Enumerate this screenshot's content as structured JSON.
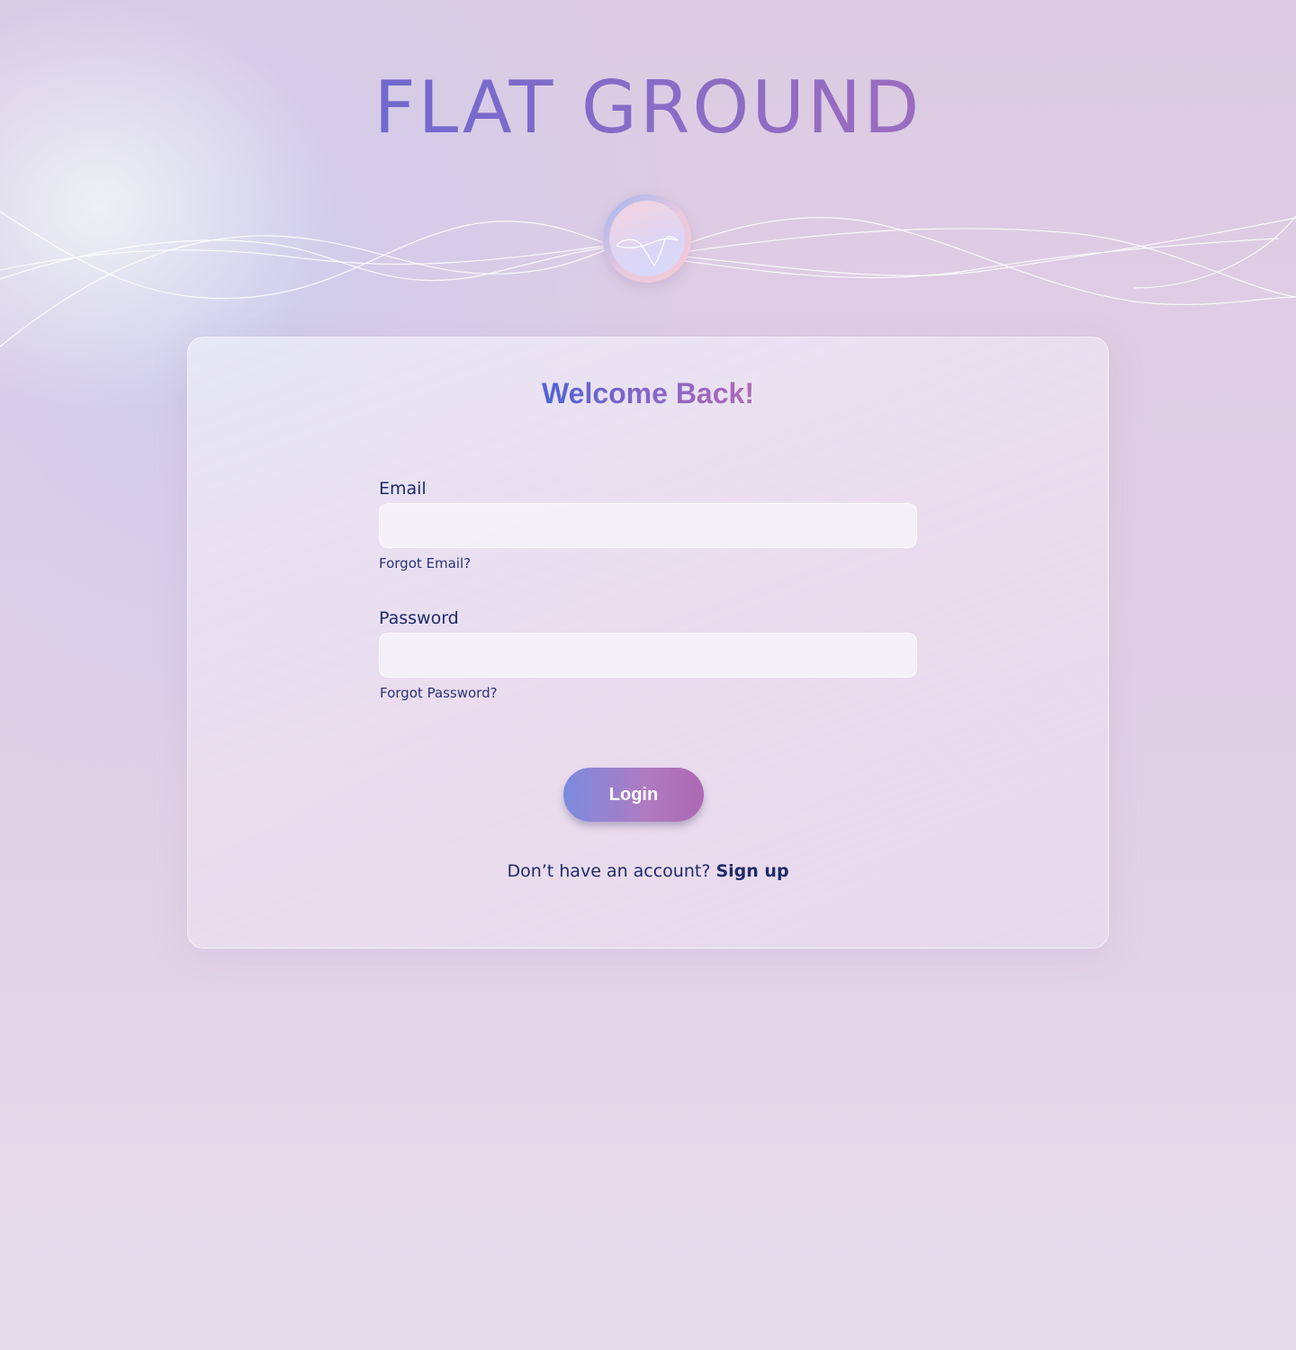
{
  "brand": {
    "title": "FLAT GROUND"
  },
  "login": {
    "title": "Welcome Back!",
    "email": {
      "label": "Email",
      "value": "",
      "forgot_link": "Forgot Email?"
    },
    "password": {
      "label": "Password",
      "value": "",
      "forgot_link": "Forgot Password?"
    },
    "submit_label": "Login",
    "signup_prompt": "Don’t have an account?",
    "signup_link": "Sign up"
  },
  "colors": {
    "brand_gradient_start": "#4f65d8",
    "brand_gradient_end": "#b46cb8",
    "text_primary": "#1f2a6b",
    "button_gradient_start": "#7b8bdf",
    "button_gradient_end": "#ad68b3"
  },
  "icons": {
    "logo": "wave-checkmark-emblem-icon"
  }
}
